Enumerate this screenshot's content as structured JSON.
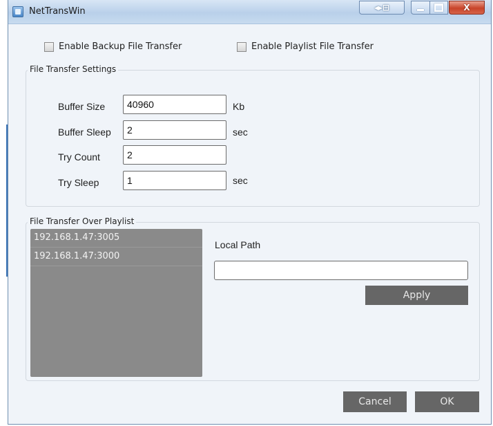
{
  "window": {
    "title": "NetTransWin",
    "controls": {
      "extra_icon": "window-switch-icon",
      "minimize_icon": "minimize-icon",
      "maximize_icon": "maximize-icon",
      "close_glyph": "X"
    }
  },
  "options": {
    "enable_backup": {
      "label": "Enable Backup File Transfer",
      "checked": false
    },
    "enable_playlist": {
      "label": "Enable Playlist File Transfer",
      "checked": false
    }
  },
  "settings": {
    "legend": "File Transfer Settings",
    "buffer_size": {
      "label": "Buffer Size",
      "value": "40960",
      "unit": "Kb"
    },
    "buffer_sleep": {
      "label": "Buffer Sleep",
      "value": "2",
      "unit": "sec"
    },
    "try_count": {
      "label": "Try Count",
      "value": "2"
    },
    "try_sleep": {
      "label": "Try Sleep",
      "value": "1",
      "unit": "sec"
    }
  },
  "playlist": {
    "legend": "File Transfer Over Playlist",
    "hosts": [
      "192.168.1.47:3005",
      "192.168.1.47:3000"
    ],
    "local_path_label": "Local Path",
    "local_path_value": "",
    "apply_label": "Apply"
  },
  "footer": {
    "cancel_label": "Cancel",
    "ok_label": "OK"
  },
  "colors": {
    "accent": "#3a73b5",
    "button_bg": "#666666",
    "listbox_bg": "#8a8a8a",
    "close_red": "#c8442a"
  }
}
